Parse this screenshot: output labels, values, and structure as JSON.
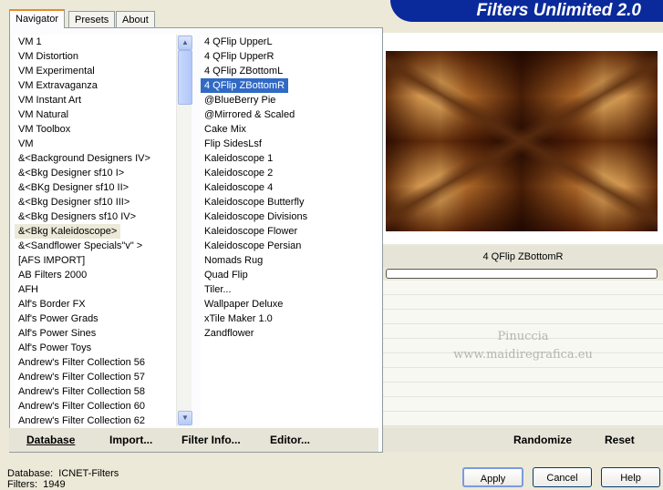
{
  "tabs": [
    {
      "label": "Navigator",
      "active": true
    },
    {
      "label": "Presets",
      "active": false
    },
    {
      "label": "About",
      "active": false
    }
  ],
  "banner_title": "Filters Unlimited 2.0",
  "categories": {
    "items": [
      "VM 1",
      "VM Distortion",
      "VM Experimental",
      "VM Extravaganza",
      "VM Instant Art",
      "VM Natural",
      "VM Toolbox",
      "VM",
      "&<Background Designers IV>",
      "&<Bkg Designer sf10 I>",
      "&<BKg Designer sf10 II>",
      "&<Bkg Designer sf10 III>",
      "&<Bkg Designers sf10 IV>",
      "&<Bkg Kaleidoscope>",
      "&<Sandflower Specials\"v\" >",
      "[AFS IMPORT]",
      "AB Filters 2000",
      "AFH",
      "Alf's Border FX",
      "Alf's Power Grads",
      "Alf's Power Sines",
      "Alf's Power Toys",
      "Andrew's Filter Collection 56",
      "Andrew's Filter Collection 57",
      "Andrew's Filter Collection 58",
      "Andrew's Filter Collection 60",
      "Andrew's Filter Collection 62"
    ],
    "selected_index": 13
  },
  "filters": {
    "items": [
      "4 QFlip UpperL",
      "4 QFlip UpperR",
      "4 QFlip ZBottomL",
      "4 QFlip ZBottomR",
      "@BlueBerry Pie",
      "@Mirrored & Scaled",
      "Cake Mix",
      "Flip SidesLsf",
      "Kaleidoscope 1",
      "Kaleidoscope 2",
      "Kaleidoscope 4",
      "Kaleidoscope Butterfly",
      "Kaleidoscope Divisions",
      "Kaleidoscope Flower",
      "Kaleidoscope Persian",
      "Nomads Rug",
      "Quad Flip",
      "Tiler...",
      "Wallpaper Deluxe",
      "xTile Maker 1.0",
      "Zandflower"
    ],
    "selected_index": 3
  },
  "preview": {
    "filter_name": "4 QFlip ZBottomR",
    "watermark_line1": "Pinuccia",
    "watermark_line2": "www.maidiregrafica.eu"
  },
  "bottom_left_buttons": {
    "database": "Database",
    "import": "Import...",
    "filter_info": "Filter Info...",
    "editor": "Editor..."
  },
  "bottom_right_buttons": {
    "randomize": "Randomize",
    "reset": "Reset"
  },
  "status": {
    "database_label": "Database:",
    "database_value": "ICNET-Filters",
    "filters_label": "Filters:",
    "filters_value": "1949"
  },
  "dialog_buttons": {
    "apply": "Apply",
    "cancel": "Cancel",
    "help": "Help"
  },
  "colors": {
    "selection": "#316ac5",
    "banner": "#0a2a9b",
    "panel": "#ece9d8"
  }
}
